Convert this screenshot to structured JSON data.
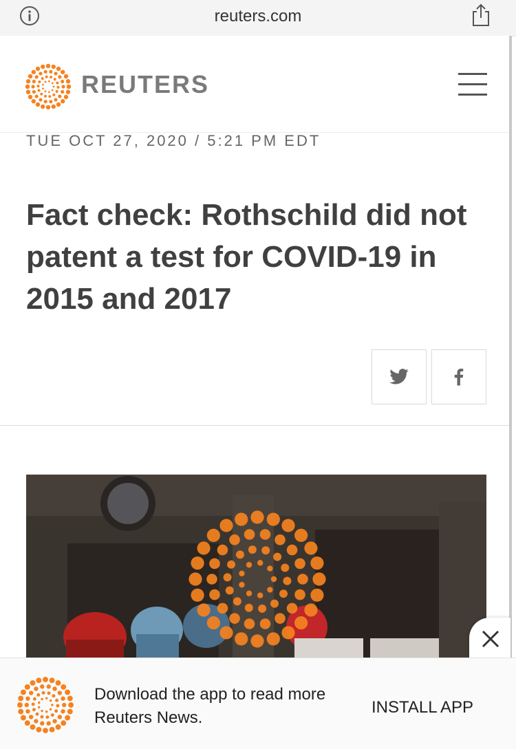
{
  "browser": {
    "domain": "reuters.com",
    "info_icon": "info-icon",
    "share_icon": "share-icon"
  },
  "header": {
    "brand": "REUTERS",
    "logo_icon": "reuters-logo-icon",
    "menu_icon": "hamburger-menu-icon"
  },
  "article": {
    "dateline": "TUE OCT 27, 2020 / 5:21 PM EDT",
    "headline": "Fact check: Rothschild did not patent a test for COVID-19 in 2015 and 2017",
    "share": {
      "twitter_icon": "twitter-icon",
      "facebook_icon": "facebook-icon"
    }
  },
  "banner": {
    "message": "Download the app to read more Reuters News.",
    "install_label": "INSTALL APP",
    "close_icon": "close-icon"
  },
  "colors": {
    "brand_orange": "#f58220",
    "text_dark": "#404040"
  }
}
